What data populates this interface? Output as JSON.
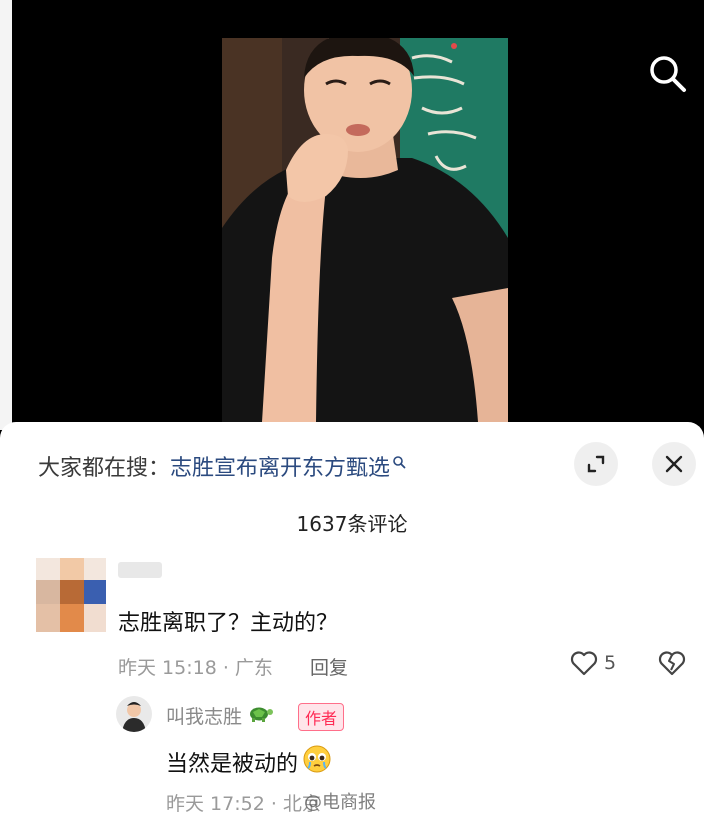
{
  "video": {
    "background_color": "#000000",
    "banner_color": "#1f7a63"
  },
  "hot_search": {
    "prefix": "大家都在搜：",
    "term": "志胜宣布离开东方甄选",
    "term_color": "#2b4a7f"
  },
  "comments": {
    "count_label": "1637条评论",
    "items": [
      {
        "text": "志胜离职了？主动的？",
        "meta": "昨天 15:18 · 广东",
        "reply_label": "回复",
        "likes": "5",
        "reply": {
          "author": "叫我志胜",
          "author_badge": "作者",
          "text": "当然是被动的",
          "meta": "昨天 17:52 · 北京",
          "badge_color": "#ff2c55"
        }
      }
    ]
  },
  "watermark": "@电商报"
}
